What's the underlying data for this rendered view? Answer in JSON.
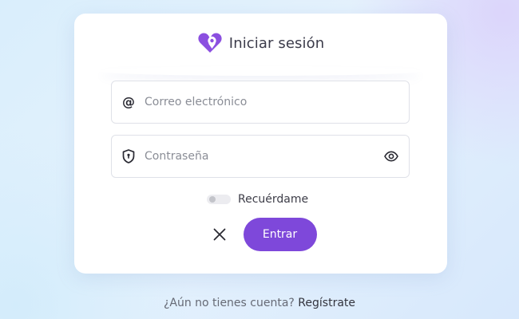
{
  "header": {
    "title": "Iniciar sesión",
    "logo_icon": "heart-location-icon",
    "brand_color": "#7e48da"
  },
  "form": {
    "email": {
      "icon": "at-icon",
      "glyph": "@",
      "placeholder": "Correo electrónico",
      "value": ""
    },
    "password": {
      "icon": "shield-icon",
      "placeholder": "Contraseña",
      "value": "",
      "toggle_icon": "eye-icon"
    },
    "remember": {
      "label": "Recuérdame",
      "checked": false
    },
    "cancel_icon": "close-icon",
    "submit_label": "Entrar"
  },
  "footer": {
    "prompt": "¿Aún no tienes cuenta?",
    "register_label": "Regístrate"
  }
}
